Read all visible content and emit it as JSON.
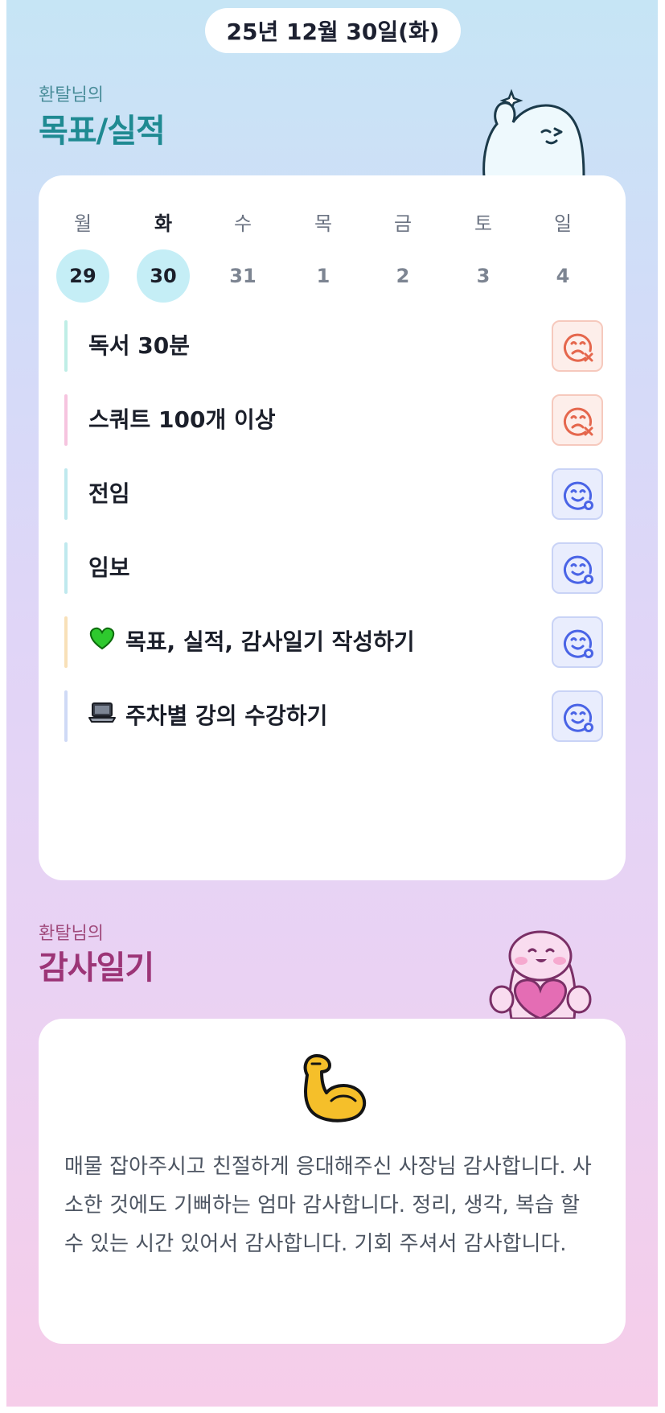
{
  "header": {
    "date": "25년 12월 30일(화)"
  },
  "goals_section": {
    "subtitle": "환탈님의",
    "title": "목표/실적",
    "week": {
      "days": [
        {
          "name": "월",
          "num": "29",
          "highlight": true,
          "today": false
        },
        {
          "name": "화",
          "num": "30",
          "highlight": true,
          "today": true
        },
        {
          "name": "수",
          "num": "31",
          "highlight": false,
          "today": false
        },
        {
          "name": "목",
          "num": "1",
          "highlight": false,
          "today": false
        },
        {
          "name": "금",
          "num": "2",
          "highlight": false,
          "today": false
        },
        {
          "name": "토",
          "num": "3",
          "highlight": false,
          "today": false
        },
        {
          "name": "일",
          "num": "4",
          "highlight": false,
          "today": false
        }
      ]
    },
    "goals": [
      {
        "label": "독서 30분",
        "status": "fail",
        "bar_color": "#bfeee6",
        "emoji": ""
      },
      {
        "label": "스쿼트 100개 이상",
        "status": "fail",
        "bar_color": "#f6c4df",
        "emoji": ""
      },
      {
        "label": "전임",
        "status": "done",
        "bar_color": "#bfe9ee",
        "emoji": ""
      },
      {
        "label": "임보",
        "status": "done",
        "bar_color": "#bfe9ee",
        "emoji": ""
      },
      {
        "label": "목표, 실적, 감사일기 작성하기",
        "status": "done",
        "bar_color": "#f8e0b8",
        "emoji": "green-heart-icon"
      },
      {
        "label": "주차별 강의 수강하기",
        "status": "done",
        "bar_color": "#cfdaf6",
        "emoji": "laptop-icon"
      }
    ]
  },
  "diary_section": {
    "subtitle": "환탈님의",
    "title": "감사일기",
    "emoji": "flexed-biceps-icon",
    "text": "매물 잡아주시고 친절하게 응대해주신 사장님 감사합니다. 사소한 것에도 기뻐하는 엄마 감사합니다. 정리, 생각, 복습 할 수 있는 시간 있어서 감사합니다. 기회 주셔서 감사합니다."
  },
  "colors": {
    "goal_title": "#1f8a92",
    "diary_title": "#9c3577",
    "fail_icon": "#e5674d",
    "done_icon": "#4a64e6",
    "day_highlight": "#c5eef6"
  }
}
